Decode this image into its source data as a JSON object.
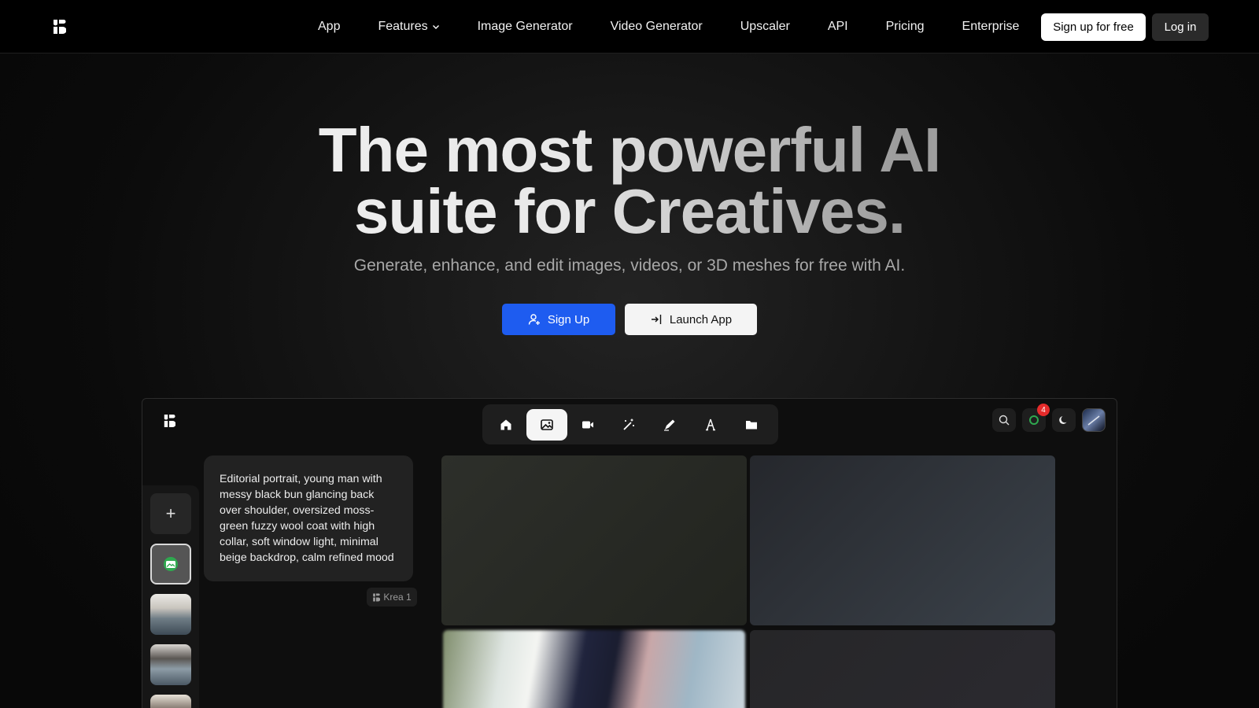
{
  "nav": {
    "logo_icon": "krea-logo-icon",
    "links": [
      "App",
      "Features",
      "Image Generator",
      "Video Generator",
      "Upscaler",
      "API",
      "Pricing",
      "Enterprise"
    ],
    "signup_label": "Sign up for free",
    "login_label": "Log in"
  },
  "hero": {
    "title_line1": "The most powerful AI",
    "title_line2": "suite for Creatives.",
    "subtitle": "Generate, enhance, and edit images, videos, or 3D meshes for free with AI.",
    "primary_label": "Sign Up",
    "secondary_label": "Launch App"
  },
  "preview": {
    "toolbar": [
      "home-icon",
      "image-icon",
      "video-icon",
      "enhance-icon",
      "edit-icon",
      "text-icon",
      "folder-icon"
    ],
    "active_tool": "image-icon",
    "notification_count": "4",
    "prompt": "Editorial portrait, young man with messy black bun glancing back over shoulder, oversized moss-green fuzzy wool coat with high collar, soft window light, minimal beige backdrop, calm refined mood",
    "model": "Krea 1",
    "add_label": "+"
  },
  "colors": {
    "accent": "#1e5cf0",
    "background": "#000000"
  }
}
